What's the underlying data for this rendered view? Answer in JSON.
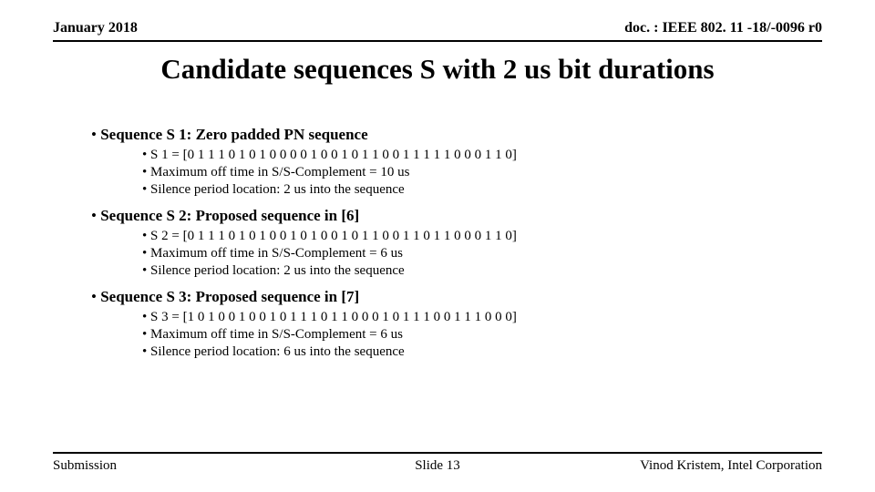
{
  "header": {
    "date": "January 2018",
    "doc": "doc. : IEEE 802. 11 -18/-0096 r0"
  },
  "title": "Candidate sequences S with 2 us bit durations",
  "sequences": [
    {
      "heading": "Sequence S 1: Zero padded PN sequence",
      "bits": "S 1 = [0 1 1 1 0 1 0 1 0 0 0 0 1 0 0 1 0 1 1 0 0 1 1 1 1 1 0 0 0 1 1 0]",
      "maxoff": "Maximum off time in S/S-Complement = 10 us",
      "silence": "Silence period location: 2 us into the sequence"
    },
    {
      "heading": "Sequence S 2: Proposed sequence in [6]",
      "bits": "S 2 = [0 1 1 1 0 1 0 1 0 0 1 0 1 0 0 1 0 1 1 0 0 1 1 0 1 1 0 0 0 1 1 0]",
      "maxoff": "Maximum off time in S/S-Complement = 6 us",
      "silence": "Silence period location: 2 us into the sequence"
    },
    {
      "heading": "Sequence S 3: Proposed sequence in [7]",
      "bits": "S 3 = [1 0 1 0 0 1 0 0 1 0 1 1 1 0 1 1 0 0 0 1 0 1 1 1 0 0 1 1 1 0 0 0]",
      "maxoff": "Maximum off time in S/S-Complement = 6 us",
      "silence": "Silence period location: 6 us into the sequence"
    }
  ],
  "footer": {
    "left": "Submission",
    "center": "Slide 13",
    "right": "Vinod Kristem, Intel Corporation"
  }
}
